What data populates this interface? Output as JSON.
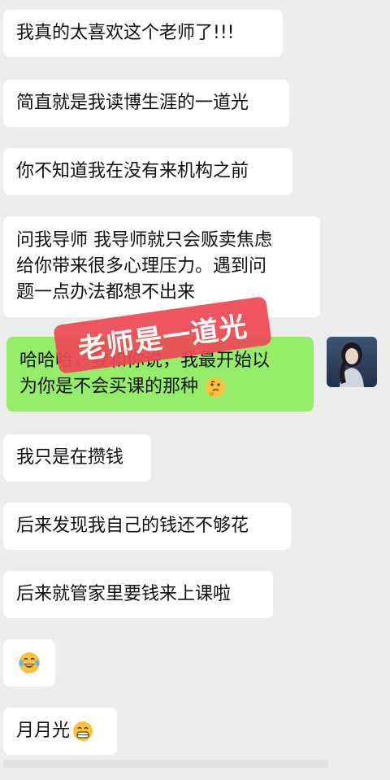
{
  "messages": [
    {
      "text": "我真的太喜欢这个老师了!!!"
    },
    {
      "text": "简直就是我读博生涯的一道光"
    },
    {
      "text": "你不知道我在没有来机构之前"
    },
    {
      "lines": [
        "问我导师 我导师就只会贩卖焦虑",
        "给你带来很多心理压力。遇到问",
        "题一点办法都想不出来"
      ]
    },
    {
      "lines": [
        "哈哈哈，我和你说，我最开始以",
        "为你是不会买课的那种"
      ],
      "emoji": "thinking-face"
    },
    {
      "text": "我只是在攒钱"
    },
    {
      "text": "后来发现我自己的钱还不够花"
    },
    {
      "text": "后来就管家里要钱来上课啦"
    },
    {
      "emoji": "tears-of-joy-face"
    },
    {
      "text": "月月光",
      "emoji": "grinning-face"
    }
  ],
  "overlay": {
    "text": "老师是一道光",
    "color": "#ee4a55"
  },
  "colors": {
    "background": "#ededed",
    "incoming": "#ffffff",
    "outgoing": "#95ec69"
  }
}
